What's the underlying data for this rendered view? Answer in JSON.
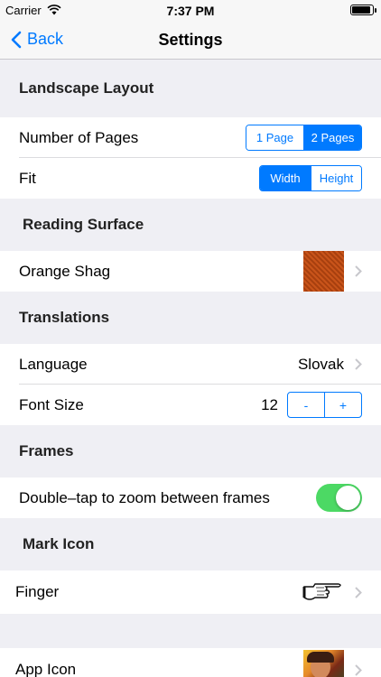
{
  "status_bar": {
    "carrier": "Carrier",
    "time": "7:37 PM",
    "battery_level": 0.9
  },
  "nav": {
    "back_label": "Back",
    "title": "Settings"
  },
  "sections": {
    "landscape": {
      "header": "Landscape Layout",
      "pages_label": "Number of Pages",
      "pages_options": [
        "1 Page",
        "2 Pages"
      ],
      "pages_selected": "2 Pages",
      "fit_label": "Fit",
      "fit_options": [
        "Width",
        "Height"
      ],
      "fit_selected": "Width"
    },
    "reading_surface": {
      "header": "Reading Surface",
      "surface_label": "Orange Shag",
      "swatch_color": "#c9541a"
    },
    "translations": {
      "header": "Translations",
      "language_label": "Language",
      "language_value": "Slovak",
      "font_size_label": "Font Size",
      "font_size_value": "12",
      "stepper_minus": "-",
      "stepper_plus": "+"
    },
    "frames": {
      "header": "Frames",
      "double_tap_label": "Double–tap to zoom between frames",
      "double_tap_on": true
    },
    "mark_icon": {
      "header": "Mark Icon",
      "icon_label": "Finger",
      "icon_name": "pointing-hand-icon"
    },
    "app_icon": {
      "label": "App Icon",
      "icon_name": "app-icon-thumbnail"
    }
  },
  "colors": {
    "accent": "#007aff",
    "toggle_on": "#4cd964",
    "background": "#efeff4"
  }
}
